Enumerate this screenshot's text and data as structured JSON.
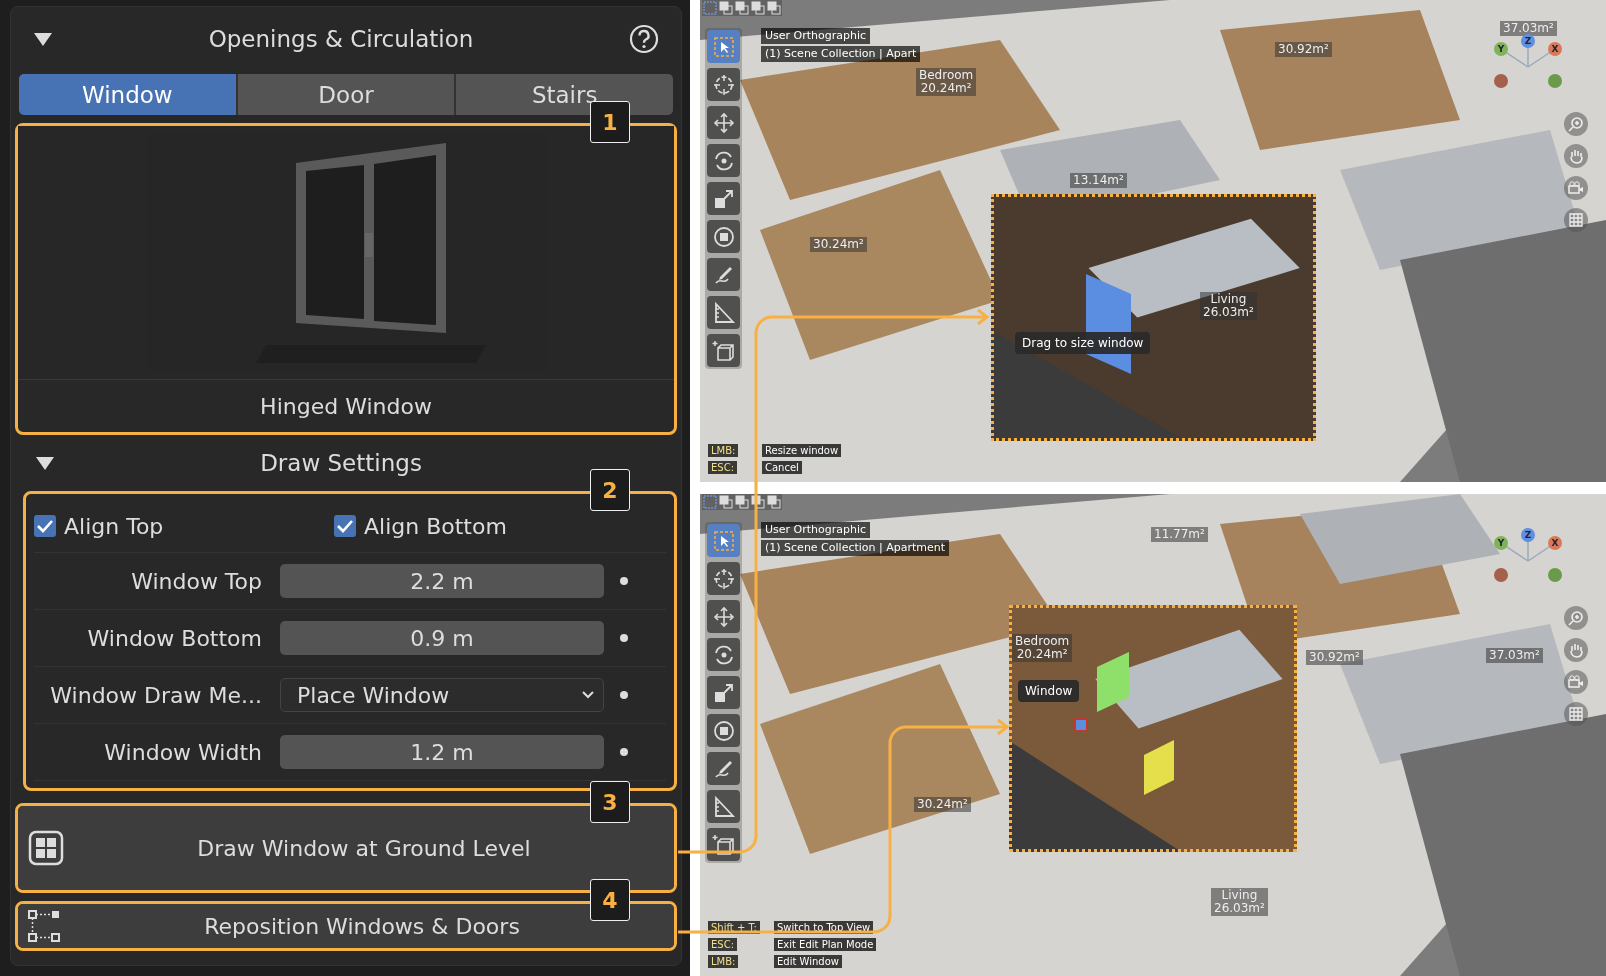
{
  "panel": {
    "title": "Openings & Circulation",
    "expanded": true,
    "tabs": [
      {
        "label": "Window",
        "selected": true
      },
      {
        "label": "Door",
        "selected": false
      },
      {
        "label": "Stairs",
        "selected": false
      }
    ],
    "preview": {
      "caption": "Hinged Window"
    },
    "draw_settings": {
      "title": "Draw Settings",
      "expanded": true,
      "checkboxes": [
        {
          "label": "Align Top",
          "checked": true
        },
        {
          "label": "Align Bottom",
          "checked": true
        }
      ],
      "fields": [
        {
          "kind": "number",
          "label": "Window Top",
          "value": "2.2 m"
        },
        {
          "kind": "number",
          "label": "Window Bottom",
          "value": "0.9 m"
        },
        {
          "kind": "dropdown",
          "label": "Window Draw Me...",
          "value": "Place Window"
        },
        {
          "kind": "number",
          "label": "Window Width",
          "value": "1.2 m"
        }
      ]
    },
    "buttons": [
      {
        "kind": "grid",
        "label": "Draw Window at Ground Level"
      },
      {
        "kind": "nodes",
        "label": "Reposition Windows & Doors"
      }
    ]
  },
  "callouts": [
    "1",
    "2",
    "3",
    "4"
  ],
  "viewports": [
    {
      "view_name": "User Orthographic",
      "collection": "(1) Scene Collection | Apart",
      "axes": [
        "Y",
        "Z",
        "X"
      ],
      "tools": [
        {
          "kind": "select",
          "selected": true
        },
        {
          "kind": "cursor",
          "selected": false
        },
        {
          "kind": "move",
          "selected": false
        },
        {
          "kind": "rotate",
          "selected": false
        },
        {
          "kind": "scale",
          "selected": false
        },
        {
          "kind": "transform",
          "selected": false
        },
        {
          "kind": "annotate",
          "selected": false
        },
        {
          "kind": "measure",
          "selected": false
        },
        {
          "kind": "add",
          "selected": false
        }
      ],
      "rooms": [
        {
          "name": "Bedroom",
          "area": "20.24m²"
        },
        {
          "name": "Living",
          "area": "26.03m²"
        },
        {
          "area": "30.24m²"
        },
        {
          "area": "30.92m²"
        },
        {
          "area": "13.14m²"
        },
        {
          "area": "37.03m²"
        }
      ],
      "tooltip": "Drag to size window",
      "hints": [
        {
          "key": "LMB:",
          "action": "Resize window"
        },
        {
          "key": "ESC:",
          "action": "Cancel"
        }
      ]
    },
    {
      "view_name": "User Orthographic",
      "collection": "(1) Scene Collection | Apartment",
      "axes": [
        "Y",
        "Z",
        "X"
      ],
      "tools": [
        {
          "kind": "select",
          "selected": true
        },
        {
          "kind": "cursor",
          "selected": false
        },
        {
          "kind": "move",
          "selected": false
        },
        {
          "kind": "rotate",
          "selected": false
        },
        {
          "kind": "scale",
          "selected": false
        },
        {
          "kind": "transform",
          "selected": false
        },
        {
          "kind": "annotate",
          "selected": false
        },
        {
          "kind": "measure",
          "selected": false
        },
        {
          "kind": "add",
          "selected": false
        }
      ],
      "rooms": [
        {
          "name": "Bedroom",
          "area": "20.24m²"
        },
        {
          "name": "Living",
          "area": "26.03m²"
        },
        {
          "area": "30.24m²"
        },
        {
          "area": "30.92m²"
        },
        {
          "area": "37.03m²"
        },
        {
          "area": "11.77m²"
        }
      ],
      "tooltip": "Window",
      "hints": [
        {
          "key": "Shift + T:",
          "action": "Switch to Top View"
        },
        {
          "key": "ESC:",
          "action": "Exit Edit Plan Mode"
        },
        {
          "key": "LMB:",
          "action": "Edit Window"
        }
      ]
    }
  ]
}
